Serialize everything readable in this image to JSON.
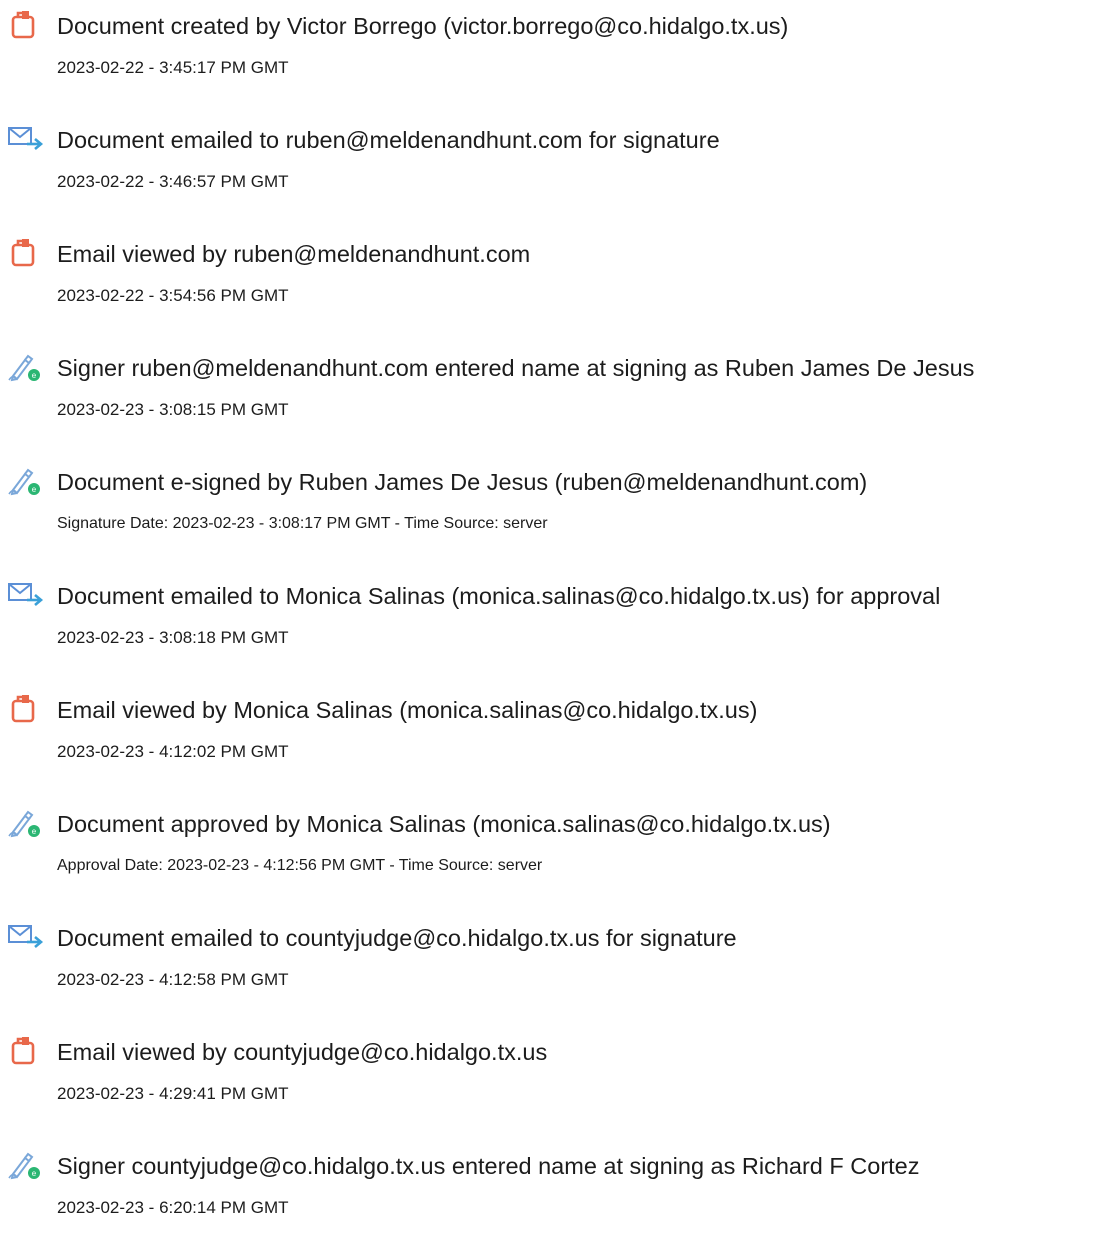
{
  "events": [
    {
      "icon": "document-created-icon",
      "title": "Document created by Victor Borrego (victor.borrego@co.hidalgo.tx.us)",
      "detail": "2023-02-22 - 3:45:17 PM GMT"
    },
    {
      "icon": "email-sent-icon",
      "title": "Document emailed to ruben@meldenandhunt.com for signature",
      "detail": "2023-02-22 - 3:46:57 PM GMT"
    },
    {
      "icon": "document-viewed-icon",
      "title": "Email viewed by ruben@meldenandhunt.com",
      "detail": "2023-02-22 - 3:54:56 PM GMT"
    },
    {
      "icon": "pen-signature-icon",
      "title": "Signer ruben@meldenandhunt.com entered name at signing as Ruben James De Jesus",
      "detail": "2023-02-23 - 3:08:15 PM GMT"
    },
    {
      "icon": "pen-signature-icon",
      "title": "Document e-signed by Ruben James De Jesus (ruben@meldenandhunt.com)",
      "detail": "Signature Date: 2023-02-23 - 3:08:17 PM GMT - Time Source: server"
    },
    {
      "icon": "email-sent-icon",
      "title": "Document emailed to Monica Salinas (monica.salinas@co.hidalgo.tx.us) for approval",
      "detail": "2023-02-23 - 3:08:18 PM GMT"
    },
    {
      "icon": "document-viewed-icon",
      "title": "Email viewed by Monica Salinas (monica.salinas@co.hidalgo.tx.us)",
      "detail": "2023-02-23 - 4:12:02 PM GMT"
    },
    {
      "icon": "pen-signature-icon",
      "title": "Document approved by Monica Salinas (monica.salinas@co.hidalgo.tx.us)",
      "detail": "Approval Date: 2023-02-23 - 4:12:56 PM GMT - Time Source: server"
    },
    {
      "icon": "email-sent-icon",
      "title": "Document emailed to countyjudge@co.hidalgo.tx.us for signature",
      "detail": "2023-02-23 - 4:12:58 PM GMT"
    },
    {
      "icon": "document-viewed-icon",
      "title": "Email viewed by countyjudge@co.hidalgo.tx.us",
      "detail": "2023-02-23 - 4:29:41 PM GMT"
    },
    {
      "icon": "pen-signature-icon",
      "title": "Signer countyjudge@co.hidalgo.tx.us entered name at signing as Richard F Cortez",
      "detail": "2023-02-23 - 6:20:14 PM GMT"
    }
  ],
  "colors": {
    "document_icon": "#e8684a",
    "email_icon": "#5b8fd6",
    "email_arrow": "#3aa0d8",
    "pen_icon": "#7aa7d9",
    "pen_badge": "#2bb673",
    "text": "#1c1c1c"
  }
}
